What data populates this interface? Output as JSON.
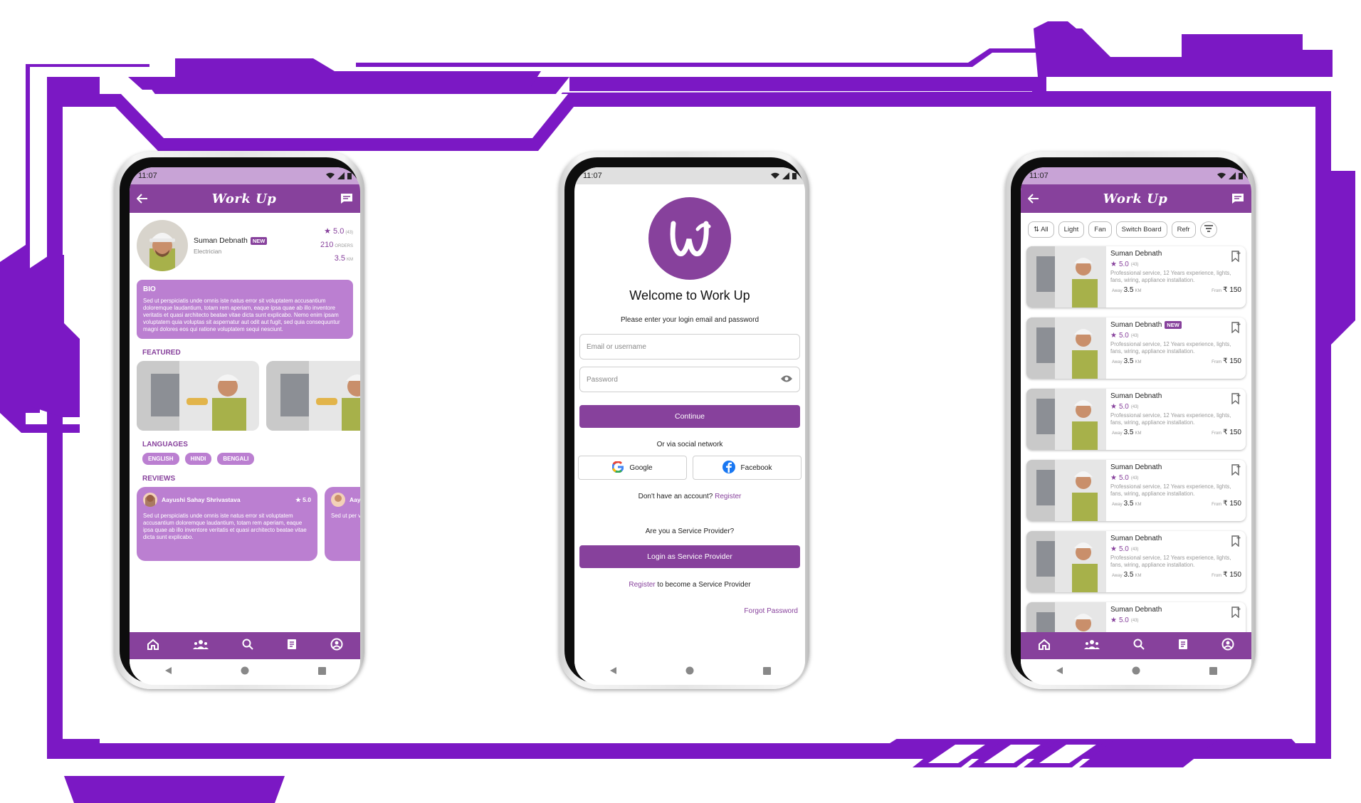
{
  "colors": {
    "brand": "#87419c",
    "brand_light": "#bb7fd1",
    "frame": "#7b18c4"
  },
  "status": {
    "time": "11:07"
  },
  "appbar": {
    "title": "Work Up"
  },
  "profile": {
    "name": "Suman Debnath",
    "badge": "NEW",
    "role": "Electrician",
    "rating": "5.0",
    "rating_count": "(43)",
    "orders": "210",
    "orders_label": "ORDERS",
    "distance": "3.5",
    "distance_label": "KM",
    "bio_title": "BIO",
    "bio_text": "Sed ut perspiciatis unde omnis iste natus error sit voluptatem accusantium doloremque laudantium, totam rem aperiam, eaque ipsa quae ab illo inventore veritatis et quasi architecto beatae vitae dicta sunt explicabo. Nemo enim ipsam voluptatem quia voluptas sit aspernatur aut odit aut fugit, sed quia consequuntur magni dolores eos qui ratione voluptatem sequi nesciunt.",
    "featured_title": "FEATURED",
    "languages_title": "LANGUAGES",
    "languages": [
      "ENGLISH",
      "HINDI",
      "BENGALI"
    ],
    "reviews_title": "REVIEWS",
    "reviews": [
      {
        "user": "Aayushi Sahay Shrivastava",
        "rating": "5.0",
        "text": "Sed ut perspiciatis unde omnis iste natus error sit voluptatem accusantium doloremque laudantium, totam rem aperiam, eaque ipsa quae ab illo inventore veritatis et quasi architecto beatae vitae dicta sunt explicabo."
      },
      {
        "user": "Aay",
        "rating": "",
        "text": "Sed ut per voluptatem totam rem veritatis et explicabo."
      }
    ]
  },
  "login": {
    "welcome": "Welcome to Work Up",
    "subtitle": "Please enter your login email and password",
    "email_placeholder": "Email or username",
    "password_placeholder": "Password",
    "continue": "Continue",
    "social_text": "Or via social network",
    "google": "Google",
    "facebook": "Facebook",
    "no_account": "Don't have an account?",
    "register": "Register",
    "provider_q": "Are you a Service Provider?",
    "provider_login": "Login as Service Provider",
    "provider_register": "Register",
    "provider_register_suffix": "to become a Service Provider",
    "forgot": "Forgot Password"
  },
  "list": {
    "filters": [
      "All",
      "Light",
      "Fan",
      "Switch Board",
      "Refr"
    ],
    "cards": [
      {
        "name": "Suman Debnath",
        "badge": "",
        "rating": "5.0",
        "count": "(43)",
        "desc": "Professional service, 12 Years experience, lights, fans, wiring, appliance installation.",
        "away_label": "Away",
        "distance": "3.5",
        "km": "KM",
        "from_label": "From",
        "price": "₹ 150"
      },
      {
        "name": "Suman Debnath",
        "badge": "NEW",
        "rating": "5.0",
        "count": "(43)",
        "desc": "Professional service, 12 Years experience, lights, fans, wiring, appliance installation.",
        "away_label": "Away",
        "distance": "3.5",
        "km": "KM",
        "from_label": "From",
        "price": "₹ 150"
      },
      {
        "name": "Suman Debnath",
        "badge": "",
        "rating": "5.0",
        "count": "(43)",
        "desc": "Professional service, 12 Years experience, lights, fans, wiring, appliance installation.",
        "away_label": "Away",
        "distance": "3.5",
        "km": "KM",
        "from_label": "From",
        "price": "₹ 150"
      },
      {
        "name": "Suman Debnath",
        "badge": "",
        "rating": "5.0",
        "count": "(43)",
        "desc": "Professional service, 12 Years experience, lights, fans, wiring, appliance installation.",
        "away_label": "Away",
        "distance": "3.5",
        "km": "KM",
        "from_label": "From",
        "price": "₹ 150"
      },
      {
        "name": "Suman Debnath",
        "badge": "",
        "rating": "5.0",
        "count": "(43)",
        "desc": "Professional service, 12 Years experience, lights, fans, wiring, appliance installation.",
        "away_label": "Away",
        "distance": "3.5",
        "km": "KM",
        "from_label": "From",
        "price": "₹ 150"
      },
      {
        "name": "Suman Debnath",
        "badge": "",
        "rating": "5.0",
        "count": "(43)",
        "desc": "",
        "away_label": "",
        "distance": "",
        "km": "",
        "from_label": "",
        "price": ""
      }
    ]
  },
  "icons": {
    "back": "arrow-left-icon",
    "chat": "chat-icon",
    "home": "home-icon",
    "group": "group-icon",
    "search": "search-icon",
    "orders": "clipboard-icon",
    "profile": "profile-icon"
  }
}
